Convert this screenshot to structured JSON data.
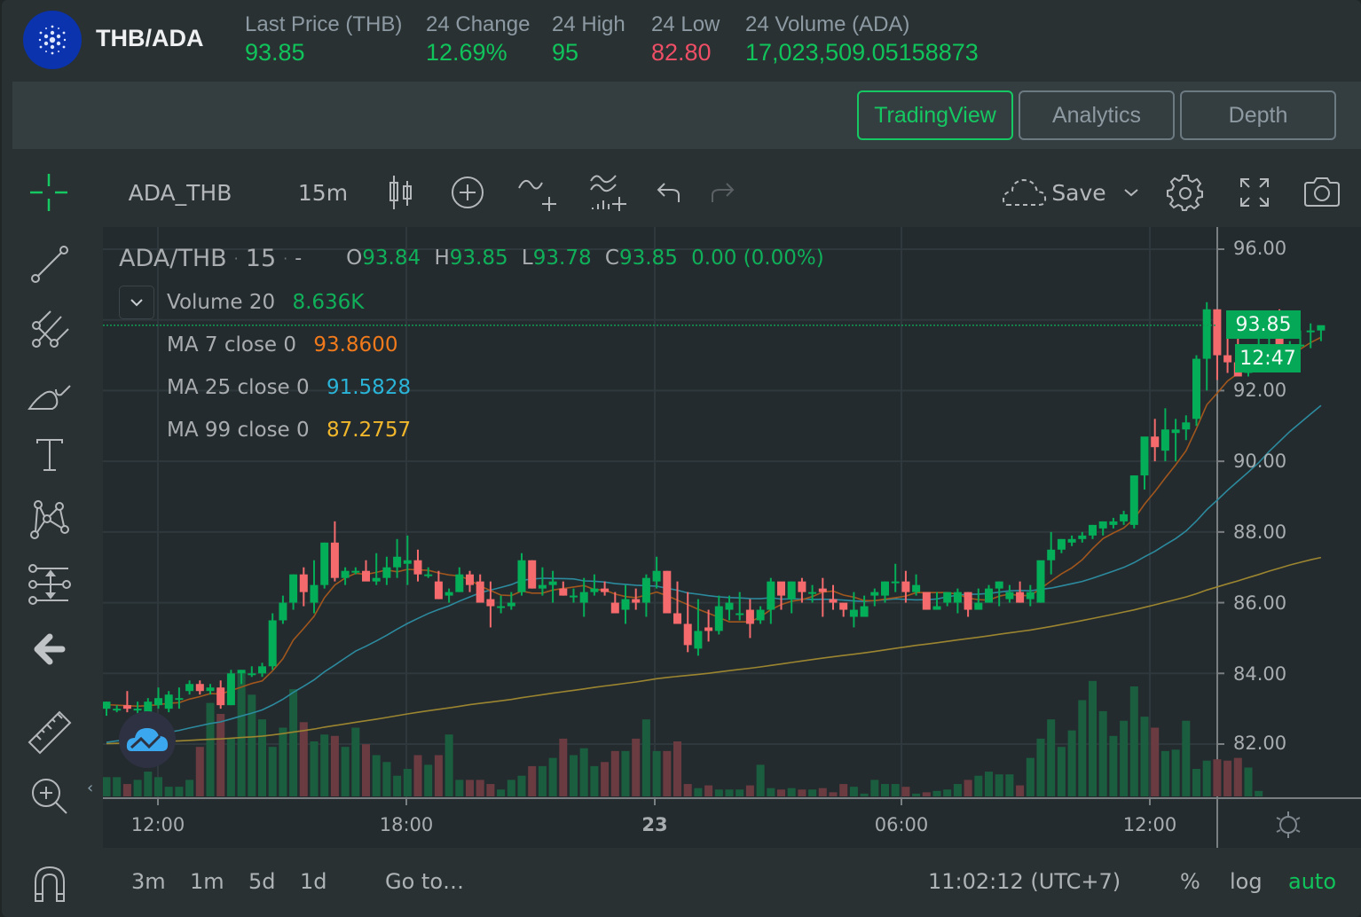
{
  "header": {
    "pair": "THB/ADA",
    "logo_icon": "cardano-logo",
    "stats": [
      {
        "label": "Last Price (THB)",
        "value": "93.85",
        "tone": "up"
      },
      {
        "label": "24 Change",
        "value": "12.69%",
        "tone": "up"
      },
      {
        "label": "24 High",
        "value": "95",
        "tone": "up"
      },
      {
        "label": "24 Low",
        "value": "82.80",
        "tone": "down"
      },
      {
        "label": "24 Volume (ADA)",
        "value": "17,023,509.05158873",
        "tone": "up"
      }
    ]
  },
  "tabs": [
    {
      "label": "TradingView",
      "active": true
    },
    {
      "label": "Analytics",
      "active": false
    },
    {
      "label": "Depth",
      "active": false
    }
  ],
  "toolbar": {
    "symbol": "ADA_THB",
    "interval": "15m",
    "save_label": "Save",
    "icons": [
      "crosshair-icon",
      "candles-icon",
      "compare-add-icon",
      "indicator-add-icon",
      "templates-icon",
      "undo-icon",
      "redo-icon",
      "cloud-icon",
      "chevron-down-icon",
      "gear-icon",
      "fullscreen-icon",
      "camera-icon"
    ]
  },
  "left_tools": [
    "trendline-icon",
    "pitchfork-icon",
    "brush-icon",
    "text-icon",
    "pattern-icon",
    "prediction-icon",
    "back-arrow-icon",
    "ruler-icon",
    "zoom-in-icon",
    "magnet-icon"
  ],
  "legend": {
    "symbol": "ADA/THB",
    "interval": "15",
    "dots": "· ·  -",
    "o_label": "O",
    "o": "93.84",
    "h_label": "H",
    "h": "93.85",
    "l_label": "L",
    "l": "93.78",
    "c_label": "C",
    "c": "93.85",
    "change": "0.00 (0.00%)",
    "volume_label": "Volume 20",
    "volume_value": "8.636K",
    "ma": [
      {
        "label": "MA 7 close 0",
        "value": "93.8600",
        "color": "#f07a1c"
      },
      {
        "label": "MA 25 close 0",
        "value": "91.5828",
        "color": "#2ab4d8"
      },
      {
        "label": "MA 99 close 0",
        "value": "87.2757",
        "color": "#f0b72c"
      }
    ]
  },
  "price_axis": {
    "ticks": [
      "96.00",
      "92.00",
      "90.00",
      "88.00",
      "86.00",
      "84.00",
      "82.00"
    ],
    "last_price": "93.85",
    "countdown": "12:47"
  },
  "time_axis": {
    "ticks": [
      "12:00",
      "18:00",
      "23",
      "06:00",
      "12:00"
    ]
  },
  "bottom_bar": {
    "ranges": [
      "3m",
      "1m",
      "5d",
      "1d"
    ],
    "goto": "Go to…",
    "clock": "11:02:12 (UTC+7)",
    "percent": "%",
    "log": "log",
    "auto": "auto"
  },
  "colors": {
    "up": "#04ad58",
    "down": "#f56b6d",
    "accent": "#16c862",
    "ma7": "#a0561d",
    "ma25": "#2c8a9e",
    "ma99": "#9b8530"
  },
  "chart_data": {
    "type": "candlestick",
    "symbol": "ADA/THB",
    "interval": "15m",
    "ylim": [
      80.5,
      96.6
    ],
    "y_ticks": [
      82,
      84,
      86,
      88,
      90,
      92,
      96
    ],
    "x_ticks": [
      "12:00",
      "18:00",
      "23",
      "06:00",
      "12:00"
    ],
    "candles": [
      [
        83.0,
        83.2,
        82.8,
        83.2
      ],
      [
        83.0,
        83.1,
        82.9,
        83.0
      ],
      [
        83.1,
        83.5,
        82.9,
        83.0
      ],
      [
        83.0,
        83.2,
        82.8,
        83.0
      ],
      [
        82.9,
        83.3,
        82.8,
        83.2
      ],
      [
        83.1,
        83.6,
        83.0,
        83.3
      ],
      [
        83.0,
        83.5,
        82.9,
        83.4
      ],
      [
        83.3,
        83.6,
        83.0,
        83.3
      ],
      [
        83.5,
        83.8,
        83.4,
        83.7
      ],
      [
        83.7,
        83.8,
        83.4,
        83.5
      ],
      [
        83.5,
        83.7,
        83.4,
        83.6
      ],
      [
        83.6,
        83.8,
        83.0,
        83.1
      ],
      [
        83.1,
        84.1,
        83.1,
        84.0
      ],
      [
        84.0,
        84.1,
        83.7,
        84.1
      ],
      [
        84.0,
        84.2,
        83.9,
        84.0
      ],
      [
        84.0,
        84.3,
        83.9,
        84.2
      ],
      [
        84.2,
        85.7,
        84.1,
        85.5
      ],
      [
        85.5,
        86.2,
        85.4,
        86.0
      ],
      [
        86.0,
        86.8,
        85.8,
        86.8
      ],
      [
        86.8,
        87.0,
        85.9,
        86.3
      ],
      [
        86.0,
        87.2,
        85.7,
        86.5
      ],
      [
        86.5,
        87.7,
        86.4,
        87.7
      ],
      [
        87.7,
        88.3,
        86.6,
        86.7
      ],
      [
        86.7,
        87.0,
        86.5,
        86.9
      ],
      [
        86.9,
        87.0,
        86.8,
        86.9
      ],
      [
        86.9,
        87.2,
        86.7,
        86.6
      ],
      [
        86.6,
        87.4,
        86.5,
        86.7
      ],
      [
        86.7,
        87.3,
        86.5,
        87.0
      ],
      [
        87.0,
        87.8,
        86.7,
        87.3
      ],
      [
        87.1,
        87.9,
        86.5,
        87.2
      ],
      [
        87.2,
        87.5,
        86.6,
        86.8
      ],
      [
        86.8,
        87.0,
        86.7,
        86.8
      ],
      [
        86.6,
        86.9,
        86.1,
        86.1
      ],
      [
        86.2,
        86.4,
        86.0,
        86.3
      ],
      [
        86.3,
        87.0,
        86.3,
        86.8
      ],
      [
        86.8,
        86.9,
        86.3,
        86.5
      ],
      [
        86.6,
        86.8,
        86.2,
        86.0
      ],
      [
        86.1,
        86.6,
        85.3,
        85.9
      ],
      [
        85.9,
        86.2,
        85.7,
        85.9
      ],
      [
        85.9,
        86.3,
        85.8,
        86.0
      ],
      [
        86.3,
        87.4,
        86.2,
        87.2
      ],
      [
        87.2,
        87.2,
        86.4,
        86.4
      ],
      [
        86.4,
        87.0,
        86.2,
        86.5
      ],
      [
        86.5,
        86.9,
        86.0,
        86.6
      ],
      [
        86.4,
        86.6,
        86.2,
        86.2
      ],
      [
        86.2,
        86.4,
        86.0,
        86.2
      ],
      [
        86.0,
        86.7,
        85.6,
        86.3
      ],
      [
        86.3,
        86.8,
        86.2,
        86.4
      ],
      [
        86.4,
        86.6,
        86.2,
        86.3
      ],
      [
        86.0,
        86.3,
        85.8,
        85.7
      ],
      [
        85.8,
        86.5,
        85.4,
        86.1
      ],
      [
        86.1,
        86.4,
        85.8,
        86.0
      ],
      [
        86.0,
        86.8,
        85.6,
        86.7
      ],
      [
        86.6,
        87.3,
        86.4,
        86.9
      ],
      [
        86.9,
        86.9,
        85.8,
        85.7
      ],
      [
        85.7,
        86.6,
        85.6,
        85.4
      ],
      [
        85.4,
        86.3,
        84.6,
        84.8
      ],
      [
        84.7,
        86.1,
        84.5,
        85.2
      ],
      [
        85.3,
        85.8,
        84.9,
        85.2
      ],
      [
        85.2,
        86.2,
        85.1,
        85.9
      ],
      [
        85.8,
        86.2,
        85.5,
        86.0
      ],
      [
        85.7,
        86.3,
        85.5,
        85.7
      ],
      [
        85.8,
        86.1,
        85.0,
        85.4
      ],
      [
        85.5,
        85.9,
        85.4,
        85.8
      ],
      [
        85.8,
        86.7,
        85.4,
        86.6
      ],
      [
        86.6,
        86.5,
        85.8,
        86.2
      ],
      [
        86.1,
        86.6,
        85.7,
        86.6
      ],
      [
        86.6,
        86.7,
        86.0,
        86.3
      ],
      [
        86.3,
        86.5,
        86.0,
        86.3
      ],
      [
        86.4,
        86.7,
        85.6,
        86.3
      ],
      [
        86.1,
        86.5,
        85.8,
        86.0
      ],
      [
        86.0,
        85.9,
        85.6,
        85.8
      ],
      [
        85.6,
        86.3,
        85.3,
        85.8
      ],
      [
        85.6,
        86.2,
        85.6,
        85.9
      ],
      [
        86.2,
        86.4,
        85.9,
        86.3
      ],
      [
        86.2,
        86.6,
        86.0,
        86.6
      ],
      [
        86.6,
        87.1,
        86.3,
        86.6
      ],
      [
        86.6,
        86.9,
        86.0,
        86.3
      ],
      [
        86.3,
        86.8,
        86.2,
        86.5
      ],
      [
        86.3,
        86.2,
        85.8,
        85.8
      ],
      [
        85.8,
        86.3,
        85.8,
        85.9
      ],
      [
        86.0,
        86.3,
        85.9,
        86.3
      ],
      [
        86.0,
        86.4,
        85.7,
        86.3
      ],
      [
        86.3,
        86.3,
        85.6,
        85.8
      ],
      [
        85.8,
        86.4,
        85.8,
        86.0
      ],
      [
        86.0,
        86.5,
        86.0,
        86.4
      ],
      [
        86.4,
        86.6,
        85.9,
        86.6
      ],
      [
        86.1,
        86.5,
        86.0,
        86.3
      ],
      [
        86.3,
        86.6,
        86.0,
        86.0
      ],
      [
        86.1,
        86.5,
        85.9,
        86.3
      ],
      [
        86.0,
        87.1,
        86.0,
        87.2
      ],
      [
        87.2,
        88.0,
        86.8,
        87.5
      ],
      [
        87.5,
        87.8,
        87.4,
        87.8
      ],
      [
        87.7,
        87.9,
        87.6,
        87.8
      ],
      [
        87.8,
        88.0,
        87.7,
        87.9
      ],
      [
        87.9,
        88.2,
        87.8,
        88.2
      ],
      [
        88.1,
        88.3,
        87.9,
        88.3
      ],
      [
        88.2,
        88.4,
        88.1,
        88.3
      ],
      [
        88.3,
        88.6,
        88.2,
        88.5
      ],
      [
        88.2,
        89.6,
        88.1,
        89.6
      ],
      [
        89.6,
        90.5,
        89.2,
        90.7
      ],
      [
        90.7,
        91.2,
        90.0,
        90.4
      ],
      [
        90.3,
        91.5,
        90.0,
        90.9
      ],
      [
        90.8,
        91.2,
        90.0,
        90.9
      ],
      [
        90.9,
        91.3,
        90.6,
        91.1
      ],
      [
        91.2,
        93.0,
        91.0,
        92.9
      ],
      [
        92.9,
        94.5,
        92.0,
        94.3
      ],
      [
        94.3,
        94.3,
        92.3,
        93.0
      ],
      [
        93.0,
        93.9,
        92.5,
        92.8
      ],
      [
        92.8,
        93.5,
        92.5,
        92.4
      ],
      [
        92.5,
        93.3,
        92.4,
        92.8
      ],
      [
        93.0,
        93.6,
        92.9,
        93.2
      ],
      [
        93.5,
        94.1,
        93.2,
        94.2
      ],
      [
        94.2,
        94.3,
        92.8,
        93.0
      ],
      [
        93.0,
        93.4,
        92.7,
        93.3
      ],
      [
        93.3,
        93.7,
        93.2,
        93.3
      ],
      [
        93.7,
        93.9,
        93.2,
        93.7
      ],
      [
        93.7,
        93.8,
        93.4,
        93.85
      ]
    ],
    "volume_relative": [
      0.14,
      0.14,
      0.09,
      0.12,
      0.18,
      0.14,
      0.07,
      0.07,
      0.12,
      0.36,
      0.68,
      0.6,
      0.42,
      0.9,
      0.74,
      0.56,
      0.36,
      0.5,
      0.78,
      0.54,
      0.4,
      0.45,
      0.44,
      0.36,
      0.5,
      0.38,
      0.3,
      0.25,
      0.15,
      0.2,
      0.3,
      0.23,
      0.3,
      0.45,
      0.12,
      0.12,
      0.12,
      0.09,
      0.05,
      0.12,
      0.15,
      0.22,
      0.22,
      0.28,
      0.42,
      0.3,
      0.35,
      0.22,
      0.25,
      0.33,
      0.33,
      0.42,
      0.56,
      0.33,
      0.33,
      0.4,
      0.09,
      0.06,
      0.08,
      0.05,
      0.05,
      0.05,
      0.08,
      0.23,
      0.06,
      0.05,
      0.06,
      0.05,
      0.05,
      0.06,
      0.03,
      0.09,
      0.07,
      0.02,
      0.12,
      0.09,
      0.09,
      0.07,
      0.02,
      0.03,
      0.04,
      0.05,
      0.09,
      0.12,
      0.15,
      0.18,
      0.16,
      0.16,
      0.08,
      0.28,
      0.42,
      0.56,
      0.36,
      0.48,
      0.7,
      0.84,
      0.62,
      0.44,
      0.55,
      0.8,
      0.58,
      0.5,
      0.33,
      0.34,
      0.55,
      0.2,
      0.26,
      0.27,
      0.26,
      0.28,
      0.21,
      0.04
    ],
    "series": [
      {
        "name": "MA 7 close 0",
        "last": 93.86
      },
      {
        "name": "MA 25 close 0",
        "last": 91.5828
      },
      {
        "name": "MA 99 close 0",
        "last": 87.2757
      }
    ],
    "last_price": 93.85
  }
}
